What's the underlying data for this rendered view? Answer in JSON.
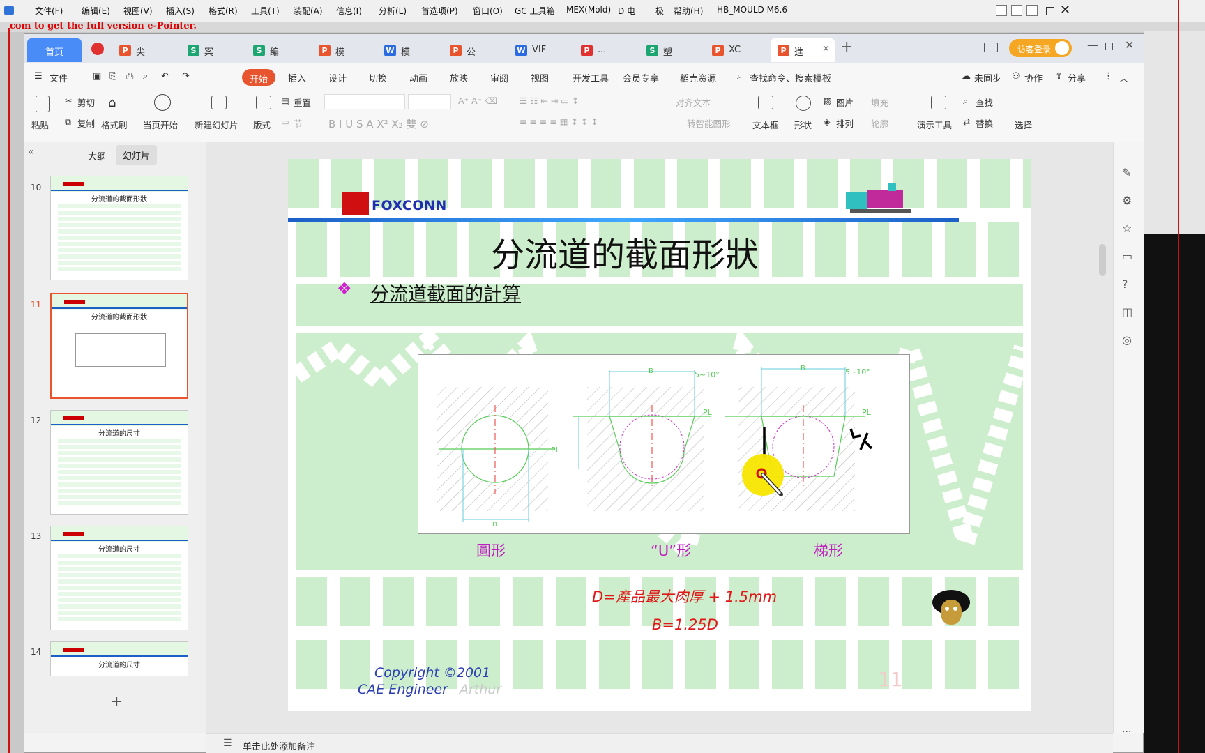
{
  "legacy_menu": [
    "文件(F)",
    "编辑(E)",
    "视图(V)",
    "插入(S)",
    "格式(R)",
    "工具(T)",
    "装配(A)",
    "信息(I)",
    "分析(L)",
    "首选项(P)",
    "窗口(O)",
    "GC 工具箱",
    "MEX(Mold)",
    "D 电",
    "极",
    "帮助(H)",
    "HB_MOULD M6.6"
  ],
  "watermark_text": "com to get the full version e-Pointer.",
  "tabs": {
    "home": "首页",
    "items": [
      {
        "label": "尖",
        "icon": "P",
        "color": "#e8542d"
      },
      {
        "label": "案",
        "icon": "S",
        "color": "#1ea672"
      },
      {
        "label": "编",
        "icon": "S",
        "color": "#1ea672"
      },
      {
        "label": "模",
        "icon": "P",
        "color": "#e8542d"
      },
      {
        "label": "模",
        "icon": "W",
        "color": "#2b6be2"
      },
      {
        "label": "公",
        "icon": "P",
        "color": "#e8542d"
      },
      {
        "label": "VIF",
        "icon": "W",
        "color": "#2b6be2"
      },
      {
        "label": "...",
        "icon": "P",
        "color": "#e03030"
      },
      {
        "label": "塑",
        "icon": "S",
        "color": "#1ea672"
      },
      {
        "label": "XC",
        "icon": "P",
        "color": "#e8542d"
      },
      {
        "label": "進",
        "icon": "P",
        "color": "#e8542d"
      }
    ],
    "add": "+",
    "login": "访客登录"
  },
  "menu": {
    "file": "文件",
    "start": "开始",
    "items": [
      "插入",
      "设计",
      "切换",
      "动画",
      "放映",
      "审阅",
      "视图",
      "开发工具",
      "会员专享",
      "稻壳资源"
    ],
    "search": "查找命令、搜索模板",
    "unsynced": "未同步",
    "collab": "协作",
    "share": "分享"
  },
  "ribbon": {
    "paste": "粘贴",
    "cut": "剪切",
    "copy": "复制",
    "format_painter": "格式刷",
    "from_start": "当页开始",
    "new_slide": "新建幻灯片",
    "layout": "版式",
    "section": "节",
    "reset": "重置",
    "align_text": "对齐文本",
    "smart_shape": "转智能图形",
    "textbox": "文本框",
    "shape": "形状",
    "picture": "图片",
    "arrange": "排列",
    "fill": "填充",
    "outline": "轮廓",
    "present_tools": "演示工具",
    "find": "查找",
    "replace": "替换",
    "select": "选择"
  },
  "left_panel": {
    "outline_tab": "大纲",
    "slides_tab": "幻灯片",
    "thumbs": [
      {
        "num": "10",
        "title": "分流道的截面形狀"
      },
      {
        "num": "11",
        "title": "分流道的截面形狀"
      },
      {
        "num": "12",
        "title": "分流道的尺寸"
      },
      {
        "num": "13",
        "title": "分流道的尺寸"
      },
      {
        "num": "14",
        "title": "分流道的尺寸"
      }
    ],
    "add": "+"
  },
  "slide": {
    "logo": "FOXCONN",
    "title": "分流道的截面形狀",
    "bullet_marker": "❖",
    "bullet": "分流道截面的計算",
    "labels": [
      "圓形",
      "“U”形",
      "梯形"
    ],
    "diagram_marks": {
      "B": "B",
      "D": "D",
      "PL": "PL",
      "angle": "5~10°"
    },
    "formula1": "D=產品最大肉厚 + 1.5mm",
    "formula2": "B=1.25D",
    "copyright_line1": "Copyright ©2001",
    "copyright_line2": "CAE Engineer",
    "author": "Arthur",
    "page_number": "11"
  },
  "notes": "单击此处添加备注",
  "colors": {
    "accent": "#e8542d",
    "tab_blue": "#4a8cf7",
    "slide_green": "#cdeecd",
    "magenta": "#c020c0",
    "red_formula": "#e01818",
    "copyright_blue": "#2c3fb0"
  }
}
